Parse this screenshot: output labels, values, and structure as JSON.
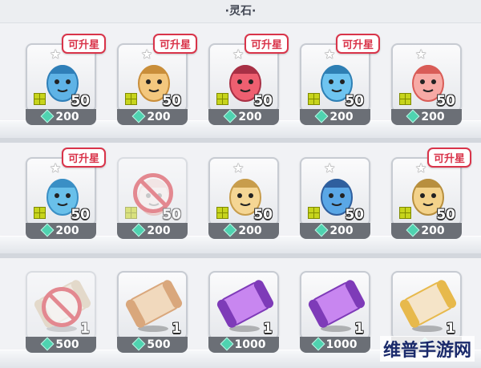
{
  "header": {
    "title": "·灵石·"
  },
  "colors": {
    "upgrade_badge": "#d9344a",
    "gem": "#4fd3b0",
    "price_bar": "#6b6f76"
  },
  "rows": [
    {
      "items": [
        {
          "name": "blue-cactus-hero",
          "count": "50",
          "price": "200",
          "badge": "可升星",
          "star": true,
          "tiles": true,
          "disabled": false,
          "art": {
            "body": "#5fb3e6",
            "accent": "#2f7fb8"
          }
        },
        {
          "name": "banana-hero",
          "count": "50",
          "price": "200",
          "badge": "可升星",
          "star": true,
          "tiles": true,
          "disabled": false,
          "art": {
            "body": "#f3c77e",
            "accent": "#c98e3a"
          }
        },
        {
          "name": "red-dragon-hero",
          "count": "50",
          "price": "200",
          "badge": "可升星",
          "star": true,
          "tiles": true,
          "disabled": false,
          "art": {
            "body": "#ee5f70",
            "accent": "#a83045"
          }
        },
        {
          "name": "blue-bird-hero",
          "count": "50",
          "price": "200",
          "badge": "可升星",
          "star": true,
          "tiles": true,
          "disabled": false,
          "art": {
            "body": "#6ec4f0",
            "accent": "#2e7fb4"
          }
        },
        {
          "name": "pink-girl-hero",
          "count": "50",
          "price": "200",
          "badge": "",
          "star": true,
          "tiles": true,
          "disabled": false,
          "art": {
            "body": "#f7aaa5",
            "accent": "#d95c57"
          }
        }
      ]
    },
    {
      "items": [
        {
          "name": "blue-cactus-variant",
          "count": "50",
          "price": "200",
          "badge": "可升星",
          "star": true,
          "tiles": true,
          "disabled": false,
          "art": {
            "body": "#69c0ea",
            "accent": "#3a8fc5"
          }
        },
        {
          "name": "white-pink-hero-locked",
          "count": "50",
          "price": "200",
          "badge": "",
          "star": false,
          "tiles": true,
          "disabled": true,
          "art": {
            "body": "#f3d9d2",
            "accent": "#e2a7a0"
          }
        },
        {
          "name": "blonde-swordsman-hero",
          "count": "50",
          "price": "200",
          "badge": "",
          "star": true,
          "tiles": true,
          "disabled": false,
          "art": {
            "body": "#f5d694",
            "accent": "#c89d4c"
          }
        },
        {
          "name": "blue-cat-hero",
          "count": "50",
          "price": "200",
          "badge": "",
          "star": true,
          "tiles": true,
          "disabled": false,
          "art": {
            "body": "#5aa7e6",
            "accent": "#2f5f9e"
          }
        },
        {
          "name": "blonde-elf-hero",
          "count": "50",
          "price": "200",
          "badge": "可升星",
          "star": true,
          "tiles": true,
          "disabled": false,
          "art": {
            "body": "#f3d28a",
            "accent": "#b88f3e"
          }
        }
      ]
    },
    {
      "items": [
        {
          "name": "common-scroll-locked",
          "count": "1",
          "price": "500",
          "badge": "",
          "star": false,
          "tiles": false,
          "disabled": true,
          "scroll": {
            "body": "#efe2cf",
            "cap": "#d8c6a8"
          }
        },
        {
          "name": "common-scroll",
          "count": "1",
          "price": "500",
          "badge": "",
          "star": false,
          "tiles": false,
          "disabled": false,
          "scroll": {
            "body": "#f1d9bd",
            "cap": "#d9a77c"
          }
        },
        {
          "name": "purple-scroll",
          "count": "1",
          "price": "1000",
          "badge": "",
          "star": false,
          "tiles": false,
          "disabled": false,
          "scroll": {
            "body": "#c886f0",
            "cap": "#7e3bb8"
          }
        },
        {
          "name": "purple-scroll-2",
          "count": "1",
          "price": "1000",
          "badge": "",
          "star": false,
          "tiles": false,
          "disabled": false,
          "scroll": {
            "body": "#c886f0",
            "cap": "#7e3bb8"
          }
        },
        {
          "name": "winged-golden-scroll",
          "count": "1",
          "price": "",
          "badge": "",
          "star": false,
          "tiles": false,
          "disabled": false,
          "scroll": {
            "body": "#f5e4c8",
            "cap": "#e7b94c"
          }
        }
      ]
    }
  ],
  "watermark": "维普手游网"
}
